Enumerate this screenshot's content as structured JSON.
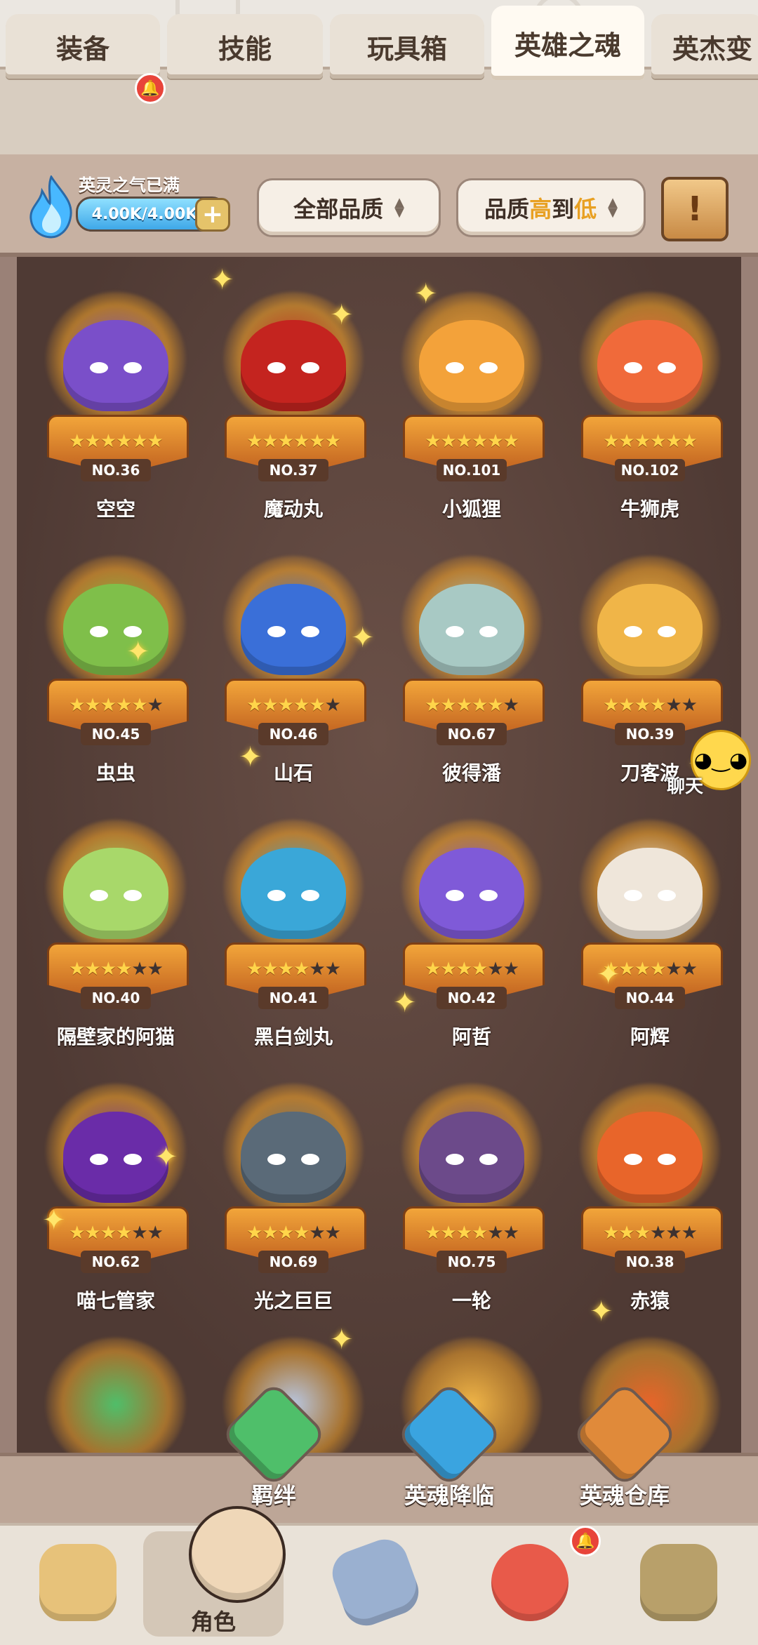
{
  "tabs": [
    {
      "label": "装备",
      "active": false,
      "badge": true
    },
    {
      "label": "技能",
      "active": false,
      "badge": false
    },
    {
      "label": "玩具箱",
      "active": false,
      "badge": false
    },
    {
      "label": "英雄之魂",
      "active": true,
      "badge": false
    },
    {
      "label": "英杰变",
      "active": false,
      "badge": false
    }
  ],
  "soul": {
    "label": "英灵之气已满",
    "value": "4.00K/4.00K",
    "plus": "+"
  },
  "filters": {
    "quality": "全部品质",
    "sort_prefix": "品质",
    "sort_hi": "高",
    "sort_mid": "到",
    "sort_lo": "低",
    "scroll_icon": "!"
  },
  "heroes": [
    {
      "no": "NO.36",
      "name": "空空",
      "stars": 6,
      "color": "#7a4fc9"
    },
    {
      "no": "NO.37",
      "name": "魔动丸",
      "stars": 6,
      "color": "#c4241f"
    },
    {
      "no": "NO.101",
      "name": "小狐狸",
      "stars": 6,
      "color": "#f3a23a"
    },
    {
      "no": "NO.102",
      "name": "牛狮虎",
      "stars": 6,
      "color": "#f06a3a"
    },
    {
      "no": "NO.45",
      "name": "虫虫",
      "stars": 5,
      "color": "#7fbf4a"
    },
    {
      "no": "NO.46",
      "name": "山石",
      "stars": 5,
      "color": "#3a6fd8"
    },
    {
      "no": "NO.67",
      "name": "彼得潘",
      "stars": 5,
      "color": "#a8c9c4"
    },
    {
      "no": "NO.39",
      "name": "刀客波",
      "stars": 4,
      "color": "#f0b548"
    },
    {
      "no": "NO.40",
      "name": "隔壁家的阿猫",
      "stars": 4,
      "color": "#a8d86a"
    },
    {
      "no": "NO.41",
      "name": "黑白剑丸",
      "stars": 4,
      "color": "#3aa7d8"
    },
    {
      "no": "NO.42",
      "name": "阿哲",
      "stars": 4,
      "color": "#7f5ad8"
    },
    {
      "no": "NO.44",
      "name": "阿辉",
      "stars": 4,
      "color": "#efe6da"
    },
    {
      "no": "NO.62",
      "name": "喵七管家",
      "stars": 4,
      "color": "#6a2ca8"
    },
    {
      "no": "NO.69",
      "name": "光之巨巨",
      "stars": 4,
      "color": "#5a6a78"
    },
    {
      "no": "NO.75",
      "name": "一轮",
      "stars": 4,
      "color": "#6c4a8a"
    },
    {
      "no": "NO.38",
      "name": "赤猿",
      "stars": 3,
      "color": "#e8652a"
    }
  ],
  "star_total": 6,
  "chat": {
    "label": "聊天",
    "icon": "chat-face-icon"
  },
  "actions": [
    {
      "label": "羁绊",
      "icon": "green-gem-icon",
      "color": "#4fbf6a"
    },
    {
      "label": "英魂降临",
      "icon": "blue-crystal-icon",
      "color": "#3aa4e0"
    },
    {
      "label": "英魂仓库",
      "icon": "orange-gem-icon",
      "color": "#e08a3a"
    }
  ],
  "nav": [
    {
      "label": "",
      "icon": "viking-helmet-icon",
      "color": "#e7c27a",
      "active": false
    },
    {
      "label": "角色",
      "icon": "character-icon",
      "color": "#efd7b8",
      "active": true
    },
    {
      "label": "",
      "icon": "sword-shield-icon",
      "color": "#9ab0d0",
      "active": false,
      "badge": false
    },
    {
      "label": "",
      "icon": "red-dino-icon",
      "color": "#e85a4a",
      "active": false,
      "badge": true
    },
    {
      "label": "",
      "icon": "goblin-face-icon",
      "color": "#b8a06a",
      "active": false
    }
  ]
}
